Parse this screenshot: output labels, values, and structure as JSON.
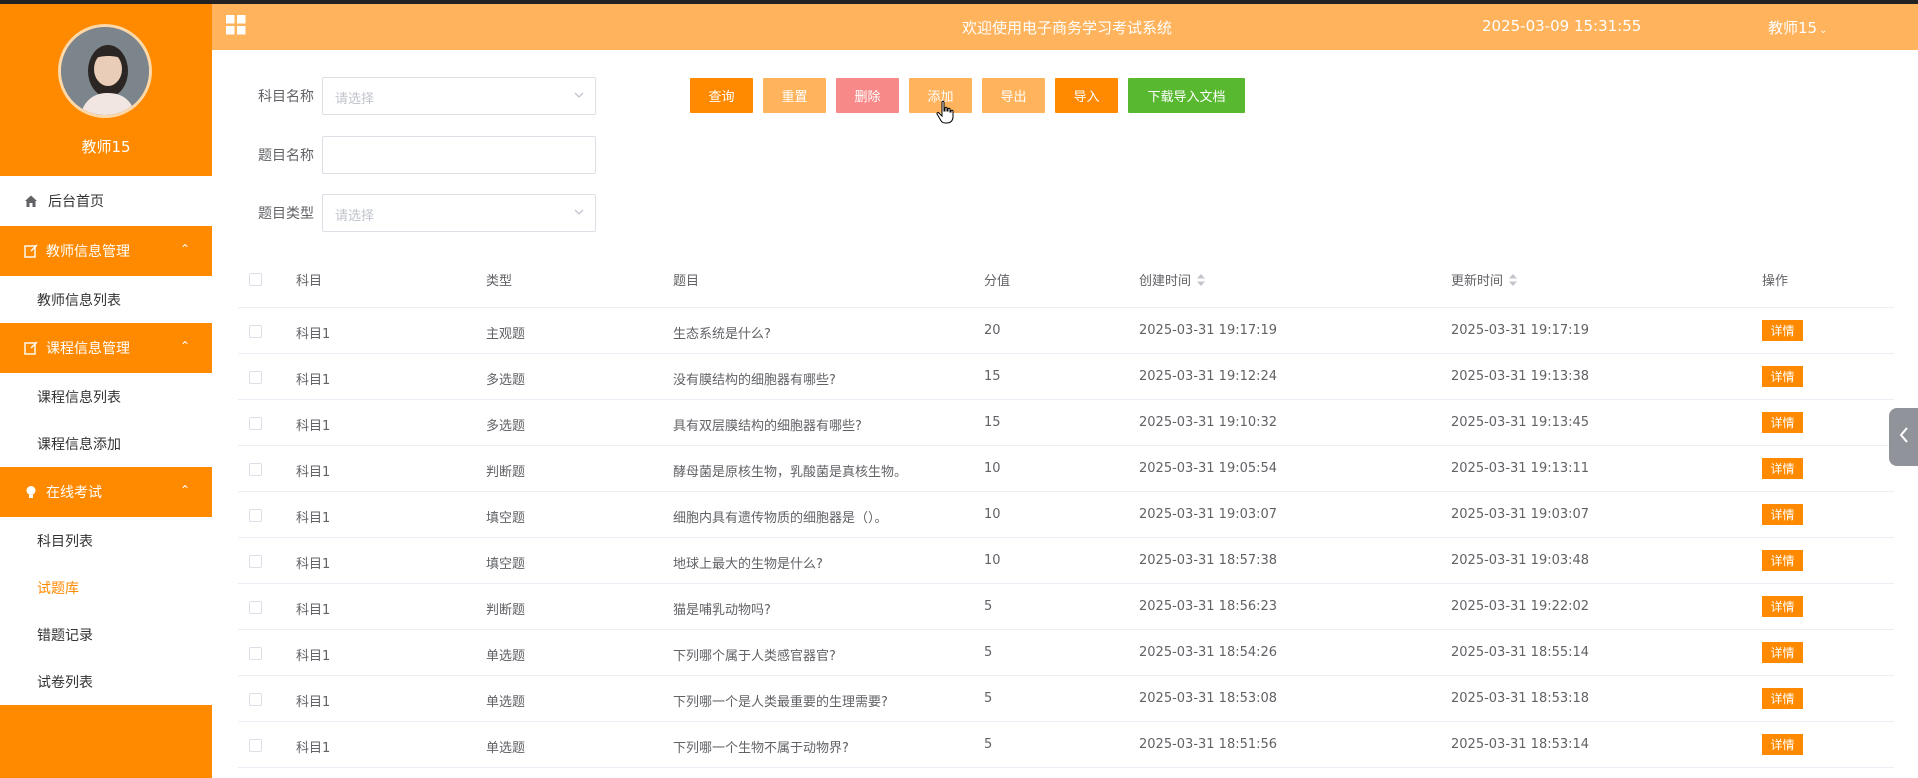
{
  "header": {
    "title": "欢迎使用电子商务学习考试系统",
    "datetime": "2025-03-09 15:31:55",
    "user": "教师15"
  },
  "sidebar": {
    "name": "教师15",
    "home": "后台首页",
    "groups": [
      {
        "label": "教师信息管理",
        "items": [
          "教师信息列表"
        ]
      },
      {
        "label": "课程信息管理",
        "items": [
          "课程信息列表",
          "课程信息添加"
        ]
      },
      {
        "label": "在线考试",
        "items": [
          "科目列表",
          "试题库",
          "错题记录",
          "试卷列表"
        ]
      }
    ],
    "active_item": "试题库"
  },
  "search": {
    "subject_label": "科目名称",
    "subject_placeholder": "请选择",
    "title_label": "题目名称",
    "title_value": "",
    "type_label": "题目类型",
    "type_placeholder": "请选择"
  },
  "buttons": {
    "query": "查询",
    "reset": "重置",
    "delete": "删除",
    "add": "添加",
    "export": "导出",
    "import": "导入",
    "download": "下载导入文档"
  },
  "colors": {
    "primary": "#ff8a00",
    "header": "#ffb35c",
    "danger_light": "#f78989",
    "light_orange": "#ffb35c",
    "success": "#58b830"
  },
  "table": {
    "columns": [
      "科目",
      "类型",
      "题目",
      "分值",
      "创建时间",
      "更新时间",
      "操作"
    ],
    "detail_label": "详情",
    "rows": [
      [
        "科目1",
        "主观题",
        "生态系统是什么?",
        "20",
        "2025-03-31 19:17:19",
        "2025-03-31 19:17:19"
      ],
      [
        "科目1",
        "多选题",
        "没有膜结构的细胞器有哪些?",
        "15",
        "2025-03-31 19:12:24",
        "2025-03-31 19:13:38"
      ],
      [
        "科目1",
        "多选题",
        "具有双层膜结构的细胞器有哪些?",
        "15",
        "2025-03-31 19:10:32",
        "2025-03-31 19:13:45"
      ],
      [
        "科目1",
        "判断题",
        "酵母菌是原核生物，乳酸菌是真核生物。",
        "10",
        "2025-03-31 19:05:54",
        "2025-03-31 19:13:11"
      ],
      [
        "科目1",
        "填空题",
        "细胞内具有遗传物质的细胞器是（）。",
        "10",
        "2025-03-31 19:03:07",
        "2025-03-31 19:03:07"
      ],
      [
        "科目1",
        "填空题",
        "地球上最大的生物是什么?",
        "10",
        "2025-03-31 18:57:38",
        "2025-03-31 19:03:48"
      ],
      [
        "科目1",
        "判断题",
        "猫是哺乳动物吗?",
        "5",
        "2025-03-31 18:56:23",
        "2025-03-31 19:22:02"
      ],
      [
        "科目1",
        "单选题",
        "下列哪个属于人类感官器官?",
        "5",
        "2025-03-31 18:54:26",
        "2025-03-31 18:55:14"
      ],
      [
        "科目1",
        "单选题",
        "下列哪一个是人类最重要的生理需要?",
        "5",
        "2025-03-31 18:53:08",
        "2025-03-31 18:53:18"
      ],
      [
        "科目1",
        "单选题",
        "下列哪一个生物不属于动物界?",
        "5",
        "2025-03-31 18:51:56",
        "2025-03-31 18:53:14"
      ]
    ]
  }
}
